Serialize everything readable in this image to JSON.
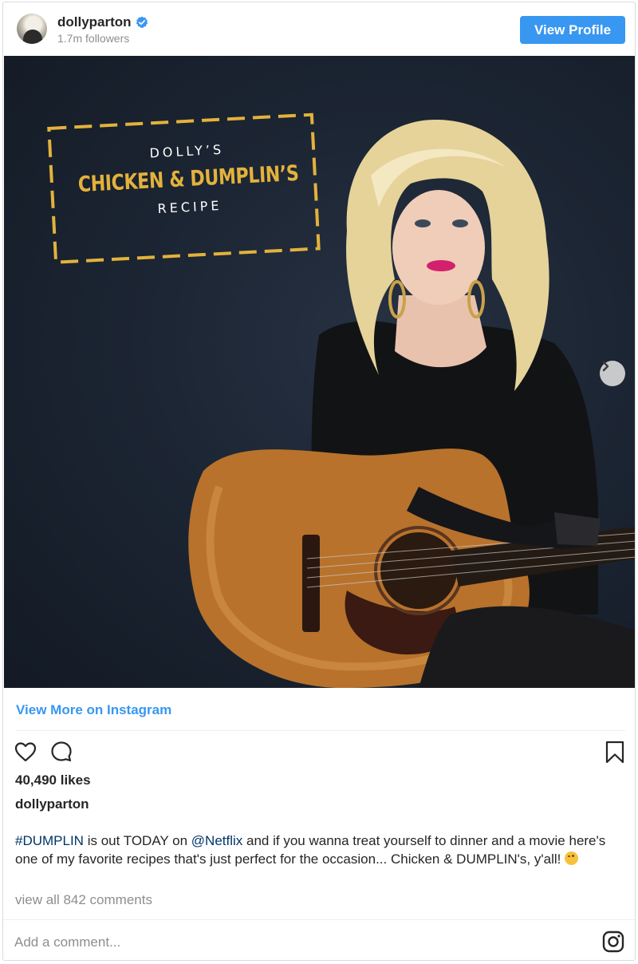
{
  "header": {
    "username": "dollyparton",
    "followers": "1.7m followers",
    "view_profile_label": "View Profile"
  },
  "media": {
    "overlay": {
      "line1": "DOLLY’S",
      "line2": "CHICKEN & DUMPLIN’S",
      "line3": "RECIPE"
    },
    "accent_color": "#e3b23c"
  },
  "view_more_label": "View More on Instagram",
  "actions": {
    "likes": "40,490 likes"
  },
  "post": {
    "caption_user": "dollyparton",
    "caption": {
      "hashtag": "#DUMPLIN",
      "text1": " is out TODAY on ",
      "mention": "@Netflix",
      "text2": " and if you wanna treat yourself to dinner and a movie here's one of my favorite recipes that's just perfect for the occasion... Chicken & DUMPLIN's, y'all! "
    },
    "view_comments": "view all 842 comments"
  },
  "comment_box": {
    "placeholder": "Add a comment..."
  },
  "colors": {
    "link_blue": "#3897f0",
    "tag_blue": "#003569",
    "text": "#262626",
    "muted": "#8e8e8e"
  },
  "icons": [
    "avatar",
    "verified-badge-icon",
    "chevron-right-icon",
    "heart-icon",
    "comment-icon",
    "bookmark-icon",
    "instagram-icon"
  ]
}
